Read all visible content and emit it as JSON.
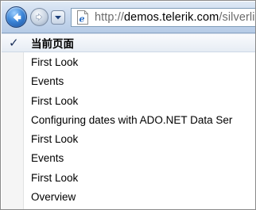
{
  "browser": {
    "url_prefix": "http://",
    "url_host": "demos.telerik.com",
    "url_path": "/silverli",
    "icons": {
      "back": "back-arrow-icon",
      "forward": "forward-arrow-icon",
      "history": "chevron-down-icon",
      "page": "ie-page-icon"
    }
  },
  "history_menu": {
    "current_page_label": "当前页面",
    "check_glyph": "✓",
    "items": [
      "First Look",
      "Events",
      "First Look",
      "Configuring dates with ADO.NET Data Ser",
      "First Look",
      "Events",
      "First Look",
      "Overview"
    ]
  },
  "colors": {
    "accent_blue": "#2a6dc4",
    "menu_gutter": "#f5f5f5"
  }
}
